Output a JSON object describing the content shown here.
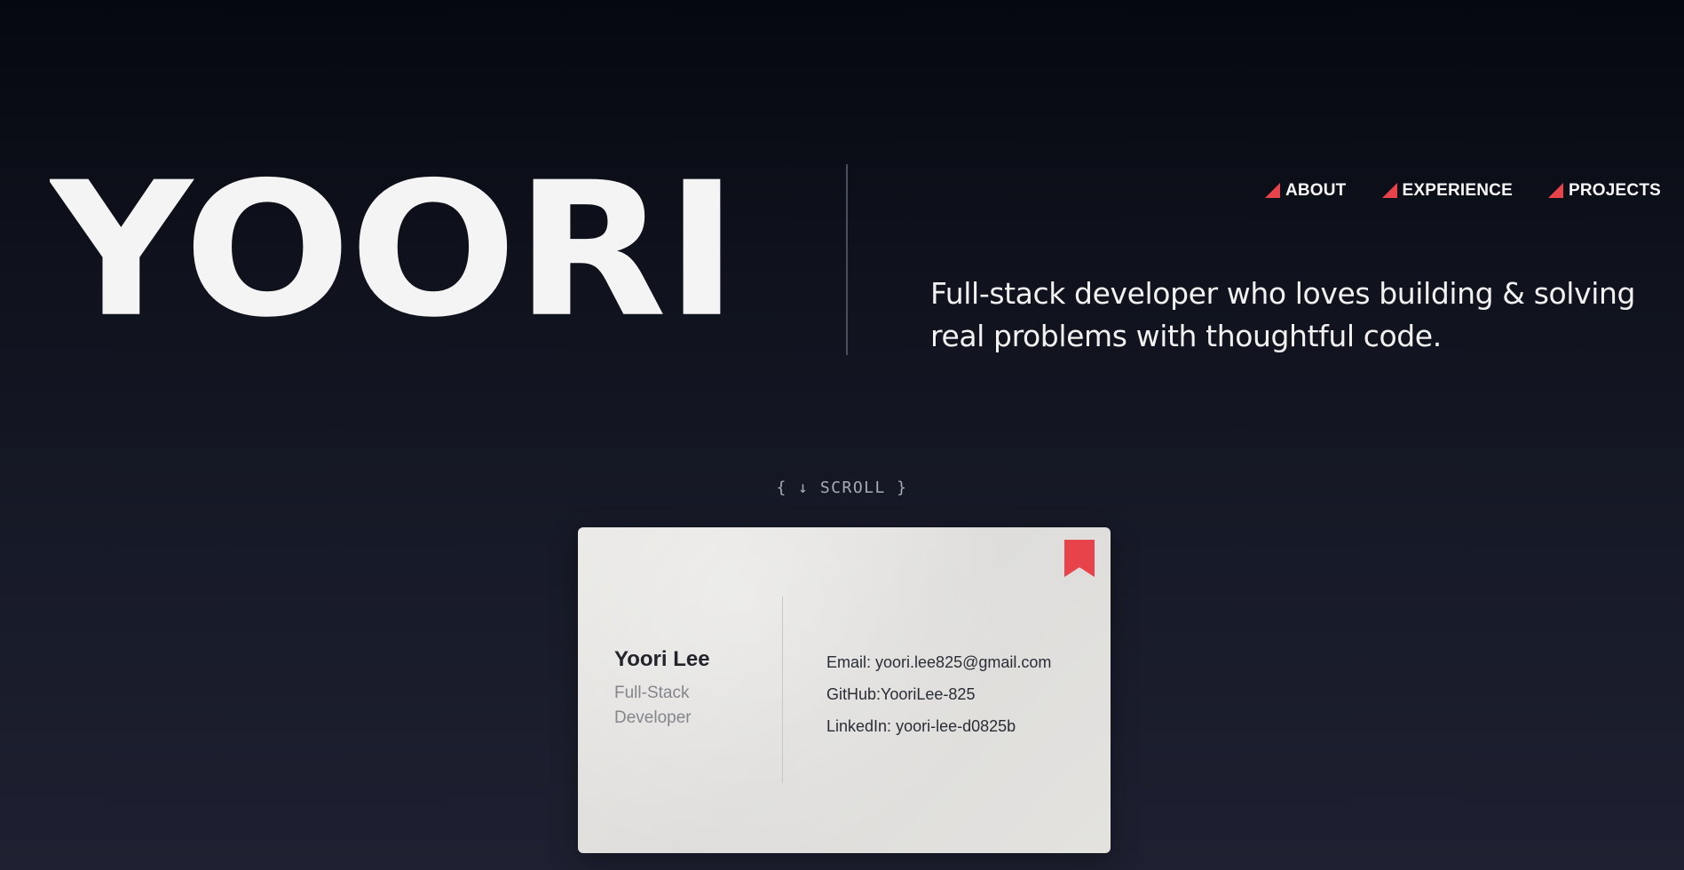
{
  "hero": {
    "wordmark": "YOORI",
    "tagline": "Full-stack developer who loves building & solving real problems with thoughtful code."
  },
  "nav": {
    "items": [
      {
        "label": "ABOUT",
        "icon": "red-triangle-icon"
      },
      {
        "label": "EXPERIENCE",
        "icon": "red-triangle-icon"
      },
      {
        "label": "PROJECTS",
        "icon": "red-triangle-icon"
      }
    ]
  },
  "scroll_hint": "{ ↓ SCROLL }",
  "card": {
    "name": "Yoori Lee",
    "role": "Full-Stack Developer",
    "icon": "bookmark-icon",
    "email_label": "Email: ",
    "email": "yoori.lee825@gmail.com",
    "github_label": "GitHub:",
    "github": "YooriLee-825",
    "linkedin_label": "LinkedIn: ",
    "linkedin": "yoori-lee-d0825b"
  },
  "colors": {
    "accent": "#e8434a",
    "background_top": "#050810",
    "background_bottom": "#1e2031",
    "text": "#f2f2f2",
    "card": "#e4e3e0"
  }
}
